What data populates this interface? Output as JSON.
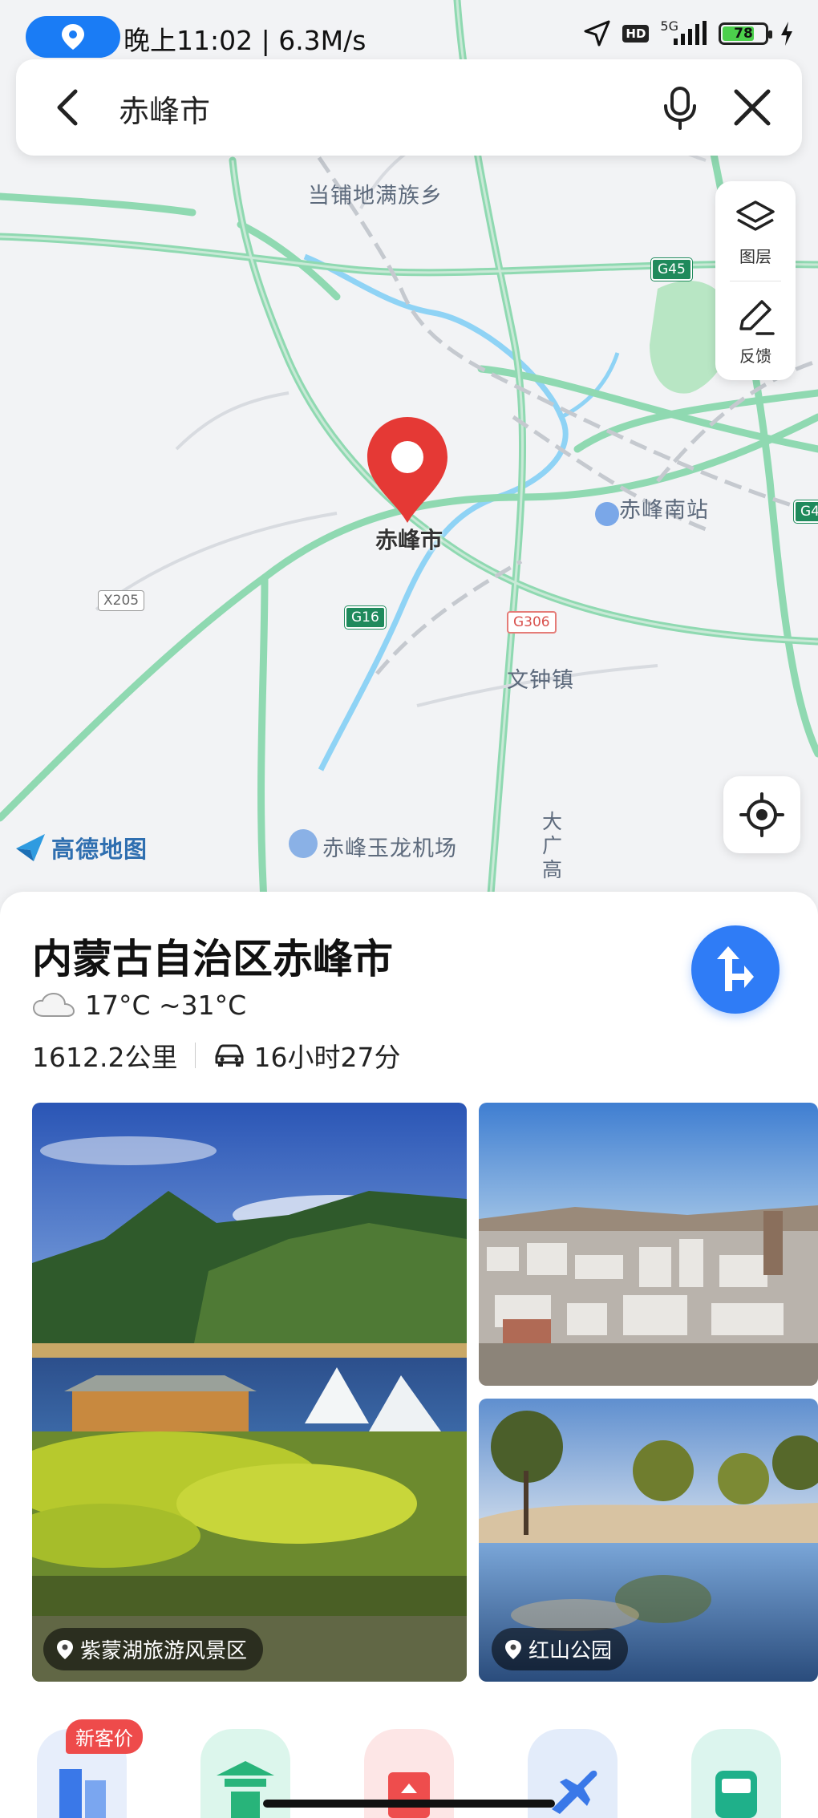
{
  "status_bar": {
    "time_speed": "晚上11:02 | 6.3M/s",
    "hd": "HD",
    "network": "5G",
    "battery": "78",
    "battery_percent": 78
  },
  "search": {
    "query": "赤峰市"
  },
  "map": {
    "labels": {
      "town_north": "当铺地满族乡",
      "station": "赤峰南站",
      "town_south": "文钟镇",
      "airport": "赤峰玉龙机场",
      "road_vertical": "大广高",
      "pin_label": "赤峰市"
    },
    "shields": {
      "g45": "G45",
      "g16": "G16",
      "g306": "G306",
      "x205": "X205",
      "g4": "G4"
    },
    "logo": "高德地图",
    "tools": {
      "layers": "图层",
      "feedback": "反馈"
    }
  },
  "sheet": {
    "title": "内蒙古自治区赤峰市",
    "weather": "17°C ~31°C",
    "distance": "1612.2公里",
    "drive_time": "16小时27分",
    "photos": [
      {
        "tag": "紫蒙湖旅游风景区"
      },
      {
        "tag": ""
      },
      {
        "tag": "红山公园"
      }
    ],
    "new_customer_badge": "新客价"
  },
  "colors": {
    "accent_blue": "#2f7cf6",
    "pin_red": "#e53935",
    "road_green": "#7fd1a6",
    "badge_red": "#ee4b4b"
  },
  "icons": [
    "location-icon",
    "back-icon",
    "mic-icon",
    "close-icon",
    "layers-icon",
    "feedback-icon",
    "locate-icon",
    "navigate-icon",
    "cloud-icon",
    "car-icon",
    "place-marker-icon"
  ]
}
